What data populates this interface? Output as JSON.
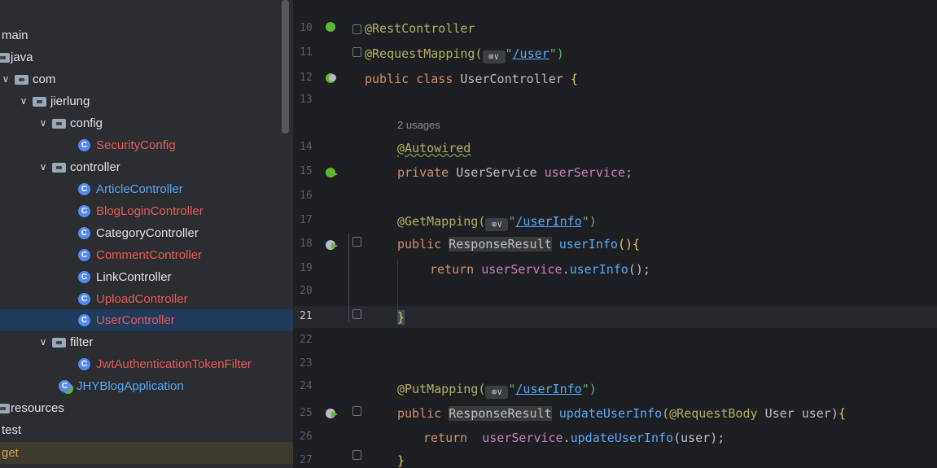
{
  "project_tree": {
    "rows": [
      {
        "label": "main",
        "kind": "text",
        "color": "plain"
      },
      {
        "label": "java",
        "kind": "folder",
        "color": "plain"
      },
      {
        "label": "com",
        "kind": "folder",
        "color": "plain",
        "chevron": "v"
      },
      {
        "label": "jierlung",
        "kind": "folder",
        "color": "plain",
        "chevron": "v"
      },
      {
        "label": "config",
        "kind": "folder",
        "color": "plain",
        "chevron": "v"
      },
      {
        "label": "SecurityConfig",
        "kind": "class",
        "color": "red"
      },
      {
        "label": "controller",
        "kind": "folder",
        "color": "plain",
        "chevron": "v"
      },
      {
        "label": "ArticleController",
        "kind": "class",
        "color": "blue"
      },
      {
        "label": "BlogLoginController",
        "kind": "class",
        "color": "red"
      },
      {
        "label": "CategoryController",
        "kind": "class",
        "color": "plain"
      },
      {
        "label": "CommentController",
        "kind": "class",
        "color": "red"
      },
      {
        "label": "LinkController",
        "kind": "class",
        "color": "plain"
      },
      {
        "label": "UploadController",
        "kind": "class",
        "color": "red"
      },
      {
        "label": "UserController",
        "kind": "class",
        "color": "red",
        "selected": true
      },
      {
        "label": "filter",
        "kind": "folder",
        "color": "plain",
        "chevron": "v"
      },
      {
        "label": "JwtAuthenticationTokenFilter",
        "kind": "class",
        "color": "red"
      },
      {
        "label": "JHYBlogApplication",
        "kind": "app",
        "color": "blue"
      },
      {
        "label": "resources",
        "kind": "folder",
        "color": "plain"
      },
      {
        "label": "test",
        "kind": "text",
        "color": "plain"
      },
      {
        "label": "get",
        "kind": "text",
        "color": "orange",
        "muted": true
      }
    ]
  },
  "editor": {
    "gutter": [
      "10",
      "11",
      "12",
      "13",
      "14",
      "15",
      "16",
      "17",
      "18",
      "19",
      "20",
      "21",
      "22",
      "23",
      "24",
      "25",
      "26",
      "27"
    ],
    "current_line": "21",
    "inlay_hint": "2 usages",
    "inlay_icon": "⊛∨",
    "code": {
      "l10": "@RestController",
      "l11_a": "@RequestMapping(",
      "l11_b": "\"",
      "l11_link": "/user",
      "l11_c": "\")",
      "l12_kw": "public class ",
      "l12_name": "UserController ",
      "l12_b": "{",
      "l14": "@Autowired",
      "l15_kw": "private ",
      "l15_type": "UserService ",
      "l15_fld": "userService",
      "l15_end": ";",
      "l17_a": "@GetMapping(",
      "l17_link": "/userInfo",
      "l18_kw": "public ",
      "l18_type": "ResponseResult",
      "l18_sp": " ",
      "l18_fn": "userInfo",
      "l18_end": "(){",
      "l19_kw": "return ",
      "l19_fld": "userService",
      "l19_dot": ".",
      "l19_mth": "userInfo",
      "l19_end": "();",
      "l21": "}",
      "l24_a": "@PutMapping(",
      "l24_link": "/userInfo",
      "l25_kw": "public ",
      "l25_type": "ResponseResult",
      "l25_fn": "updateUserInfo",
      "l25_ann": "(@RequestBody ",
      "l25_rest": "User user)",
      "l25_brace": "{",
      "l26_kw": "return  ",
      "l26_fld": "userService",
      "l26_mth": "updateUserInfo",
      "l26_end": "(user);",
      "l27": "}"
    }
  }
}
